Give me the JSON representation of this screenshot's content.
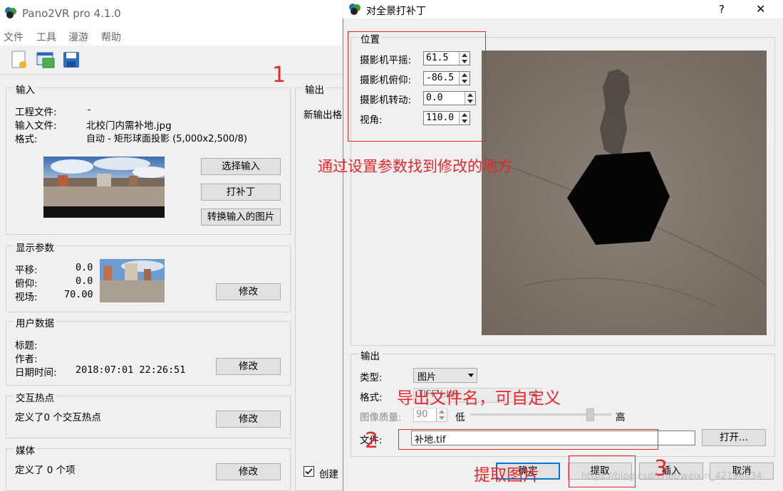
{
  "main_window": {
    "title": "Pano2VR pro 4.1.0",
    "menu": [
      "文件",
      "工具",
      "漫游",
      "帮助"
    ],
    "input_group": {
      "title": "输入",
      "project_label": "工程文件:",
      "project_value": "-",
      "input_label": "输入文件:",
      "input_value": "北校门内需补地.jpg",
      "format_label": "格式:",
      "format_value": "自动 - 矩形球面投影 (5,000x2,500/8)",
      "btn_select": "选择输入",
      "btn_patch": "打补丁",
      "btn_convert": "转换输入的图片"
    },
    "display_group": {
      "title": "显示参数",
      "pan_label": "平移:",
      "pan_value": "0.0",
      "tilt_label": "俯仰:",
      "tilt_value": "0.0",
      "fov_label": "视场:",
      "fov_value": "70.00",
      "btn_edit": "修改"
    },
    "user_group": {
      "title": "用户数据",
      "title_label": "标题:",
      "author_label": "作者:",
      "datetime_label": "日期时间:",
      "datetime_value": "2018:07:01 22:26:51",
      "btn_edit": "修改"
    },
    "hotspot_group": {
      "title": "交互热点",
      "text": "定义了0 个交互热点",
      "btn_edit": "修改"
    },
    "media_group": {
      "title": "媒体",
      "text": "定义了 0 个项",
      "btn_edit": "修改"
    },
    "output_group": {
      "title": "输出",
      "new_output": "新输出格",
      "create_label": "创建"
    }
  },
  "dialog": {
    "title": "对全景打补丁",
    "help": "?",
    "close": "✕",
    "position_group": {
      "title": "位置",
      "pan_label": "摄影机平摇:",
      "pan_value": "61.5",
      "tilt_label": "摄影机俯仰:",
      "tilt_value": "-86.5",
      "roll_label": "摄影机转动:",
      "roll_value": "0.0",
      "fov_label": "视角:",
      "fov_value": "110.0"
    },
    "output_group": {
      "title": "输出",
      "type_label": "类型:",
      "type_value": "图片",
      "format_label": "格式:",
      "format_value": "TIFF (.tif)",
      "quality_label": "图像质量:",
      "quality_value": "90",
      "low_label": "低",
      "high_label": "高",
      "quality_fraction": 0.87,
      "file_label": "文件:",
      "file_value": "补地.tif",
      "btn_open": "打开..."
    },
    "buttons": {
      "ok": "确定",
      "extract": "提取",
      "insert": "插入",
      "cancel": "取消"
    }
  },
  "annotations": {
    "n1": "1",
    "n2": "2",
    "n3": "3",
    "note_params": "通过设置参数找到修改的地方",
    "note_filename": "导出文件名，可自定义",
    "note_extract": "提取图片",
    "watermark": "https://blog.csdn.net/weixin_42196634"
  },
  "colors": {
    "annotation": "#e8262b",
    "ok_border": "#0078d7"
  }
}
